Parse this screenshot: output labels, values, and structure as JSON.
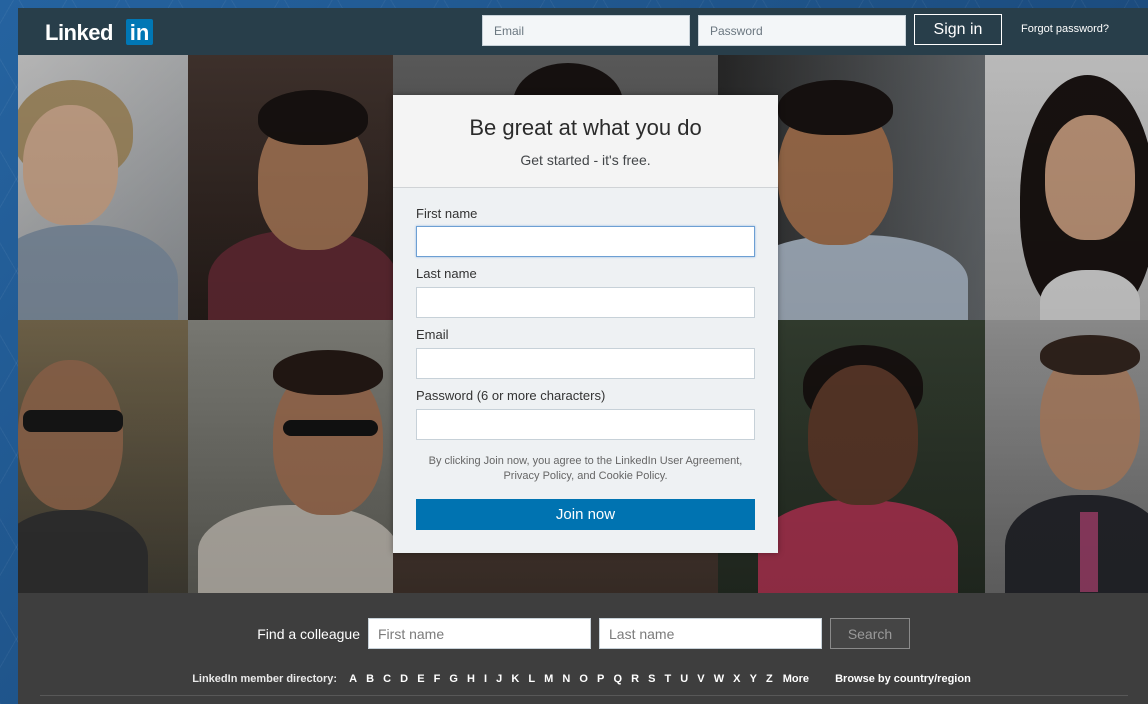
{
  "header": {
    "logo_word": "Linked",
    "logo_badge": "in",
    "email_placeholder": "Email",
    "password_placeholder": "Password",
    "signin_label": "Sign in",
    "forgot_label": "Forgot password?"
  },
  "signup": {
    "title": "Be great at what you do",
    "subtitle": "Get started - it's free.",
    "fields": [
      {
        "label": "First name",
        "value": ""
      },
      {
        "label": "Last name",
        "value": ""
      },
      {
        "label": "Email",
        "value": ""
      },
      {
        "label": "Password (6 or more characters)",
        "value": ""
      }
    ],
    "legal_line1": "By clicking Join now, you agree to the LinkedIn User Agreement,",
    "legal_line2": "Privacy Policy, and Cookie Policy.",
    "join_label": "Join now"
  },
  "footer": {
    "find_label": "Find a colleague",
    "first_placeholder": "First name",
    "last_placeholder": "Last name",
    "search_label": "Search",
    "directory_label": "LinkedIn member directory:",
    "letters": [
      "A",
      "B",
      "C",
      "D",
      "E",
      "F",
      "G",
      "H",
      "I",
      "J",
      "K",
      "L",
      "M",
      "N",
      "O",
      "P",
      "Q",
      "R",
      "S",
      "T",
      "U",
      "V",
      "W",
      "X",
      "Y",
      "Z"
    ],
    "more_label": "More",
    "browse_label": "Browse by country/region"
  },
  "colors": {
    "brand_blue": "#0073b1",
    "header_bg": "#283e4a",
    "footer_bg": "#3e3e3e",
    "outer_bg": "#1b4b7d",
    "focus_border": "#6d9fd3"
  }
}
